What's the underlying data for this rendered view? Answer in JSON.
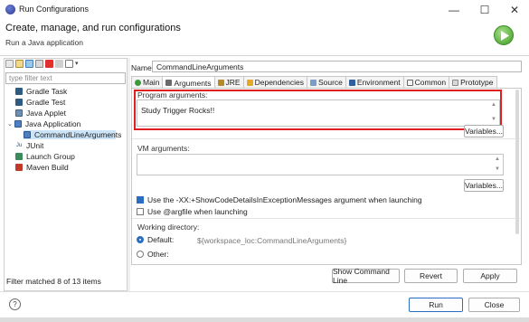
{
  "window": {
    "title": "Run Configurations",
    "minimize_glyph": "—",
    "maximize_glyph": "☐",
    "close_glyph": "✕"
  },
  "header": {
    "title": "Create, manage, and run configurations",
    "subtitle": "Run a Java application"
  },
  "left": {
    "filter_placeholder": "type filter text",
    "tree": [
      {
        "label": "Gradle Task",
        "icon": "gradle-icon",
        "indent": 1
      },
      {
        "label": "Gradle Test",
        "icon": "gradle-icon",
        "indent": 1
      },
      {
        "label": "Java Applet",
        "icon": "applet-icon",
        "indent": 1
      },
      {
        "label": "Java Application",
        "icon": "java-app-icon",
        "indent": 0,
        "expanded": true
      },
      {
        "label": "CommandLineArguments",
        "icon": "java-config-icon",
        "indent": 2,
        "selected": true
      },
      {
        "label": "JUnit",
        "icon": "junit-icon",
        "indent": 1
      },
      {
        "label": "Launch Group",
        "icon": "launch-group-icon",
        "indent": 1
      },
      {
        "label": "Maven Build",
        "icon": "maven-icon",
        "indent": 1
      }
    ],
    "filter_message": "Filter matched 8 of 13 items"
  },
  "right": {
    "name_label": "Name:",
    "name_value": "CommandLineArguments",
    "tabs": [
      {
        "label": "Main",
        "icon": "main-tab-icon"
      },
      {
        "label": "Arguments",
        "icon": "arguments-tab-icon",
        "active": true
      },
      {
        "label": "JRE",
        "icon": "jre-tab-icon"
      },
      {
        "label": "Dependencies",
        "icon": "dependencies-tab-icon"
      },
      {
        "label": "Source",
        "icon": "source-tab-icon"
      },
      {
        "label": "Environment",
        "icon": "environment-tab-icon"
      },
      {
        "label": "Common",
        "icon": "common-tab-icon"
      },
      {
        "label": "Prototype",
        "icon": "prototype-tab-icon"
      }
    ],
    "program_args_label": "Program arguments:",
    "program_args_value": "Study Trigger Rocks!!",
    "variables_btn_1": "Variables...",
    "vm_args_label": "VM arguments:",
    "vm_args_value": "",
    "variables_btn_2": "Variables...",
    "check1": "Use the -XX:+ShowCodeDetailsInExceptionMessages argument when launching",
    "check2": "Use @argfile when launching",
    "workdir_label": "Working directory:",
    "radio_default": "Default:",
    "default_path": "${workspace_loc:CommandLineArguments}",
    "radio_other": "Other:"
  },
  "buttons": {
    "show_cmd": "Show Command Line",
    "revert": "Revert",
    "apply": "Apply",
    "run": "Run",
    "close": "Close",
    "help": "?"
  },
  "colors": {
    "accent": "#2a6ec2",
    "highlight_box": "#e02020",
    "selection": "#cce4f7"
  }
}
